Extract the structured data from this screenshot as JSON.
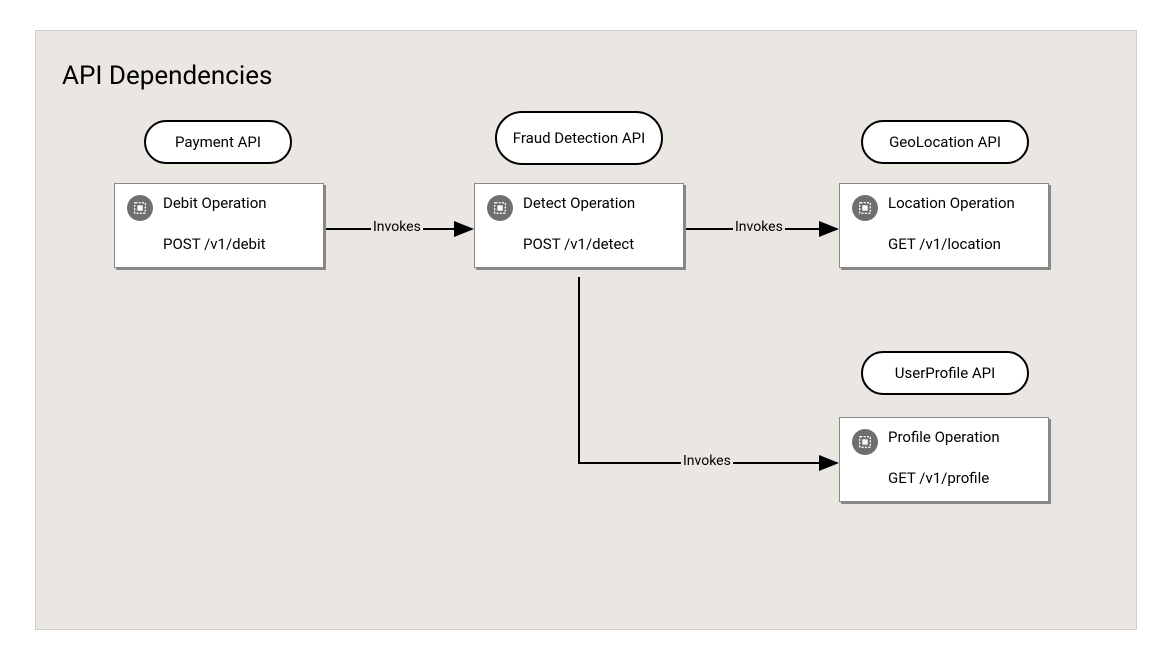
{
  "title": "API Dependencies",
  "apis": {
    "payment": {
      "label": "Payment API"
    },
    "fraud": {
      "label": "Fraud Detection API"
    },
    "geo": {
      "label": "GeoLocation API"
    },
    "profile": {
      "label": "UserProfile API"
    }
  },
  "operations": {
    "debit": {
      "name": "Debit Operation",
      "method_path": "POST /v1/debit"
    },
    "detect": {
      "name": "Detect Operation",
      "method_path": "POST /v1/detect"
    },
    "location": {
      "name": "Location Operation",
      "method_path": "GET /v1/location"
    },
    "profile": {
      "name": "Profile Operation",
      "method_path": "GET /v1/profile"
    }
  },
  "edges": {
    "invokes1": "Invokes",
    "invokes2": "Invokes",
    "invokes3": "Invokes"
  }
}
